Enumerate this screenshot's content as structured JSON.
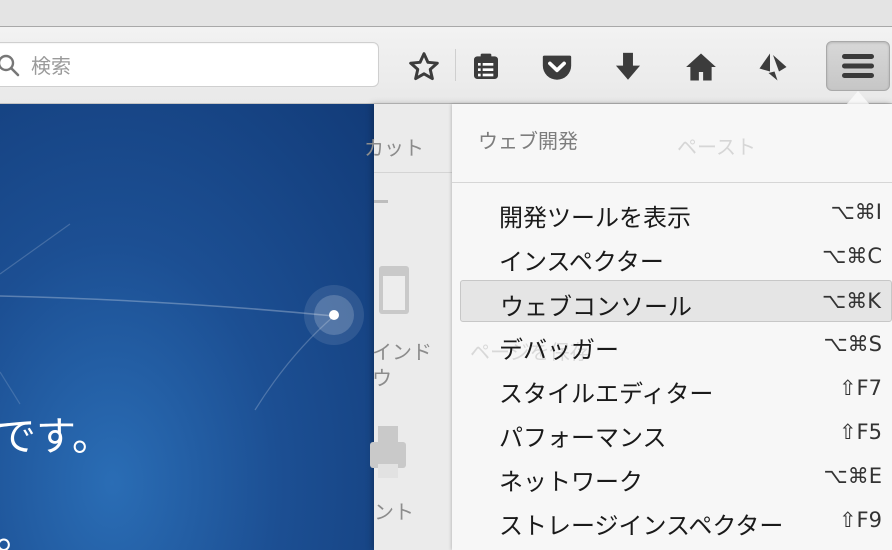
{
  "search": {
    "placeholder": "検索"
  },
  "toolbar": {
    "icons": [
      "star-icon",
      "reading-list-icon",
      "pocket-icon",
      "download-icon",
      "home-icon",
      "sync-icon",
      "hamburger-menu-icon"
    ]
  },
  "page": {
    "line1": "です。",
    "line2": "。"
  },
  "under_panel": {
    "cut_label": "カット",
    "paste_label": "ペースト",
    "window_label_1": "インド",
    "window_label_2": "ウ",
    "save_page_label": "ページを保存",
    "print_label": "ント"
  },
  "submenu": {
    "title": "ウェブ開発",
    "items": [
      {
        "label": "開発ツールを表示",
        "shortcut": "⌥⌘I"
      },
      {
        "label": "インスペクター",
        "shortcut": "⌥⌘C"
      },
      {
        "label": "ウェブコンソール",
        "shortcut": "⌥⌘K"
      },
      {
        "label": "デバッガー",
        "shortcut": "⌥⌘S"
      },
      {
        "label": "スタイルエディター",
        "shortcut": "⇧F7"
      },
      {
        "label": "パフォーマンス",
        "shortcut": "⇧F5"
      },
      {
        "label": "ネットワーク",
        "shortcut": "⌥⌘E"
      },
      {
        "label": "ストレージインスペクター",
        "shortcut": "⇧F9"
      }
    ]
  }
}
